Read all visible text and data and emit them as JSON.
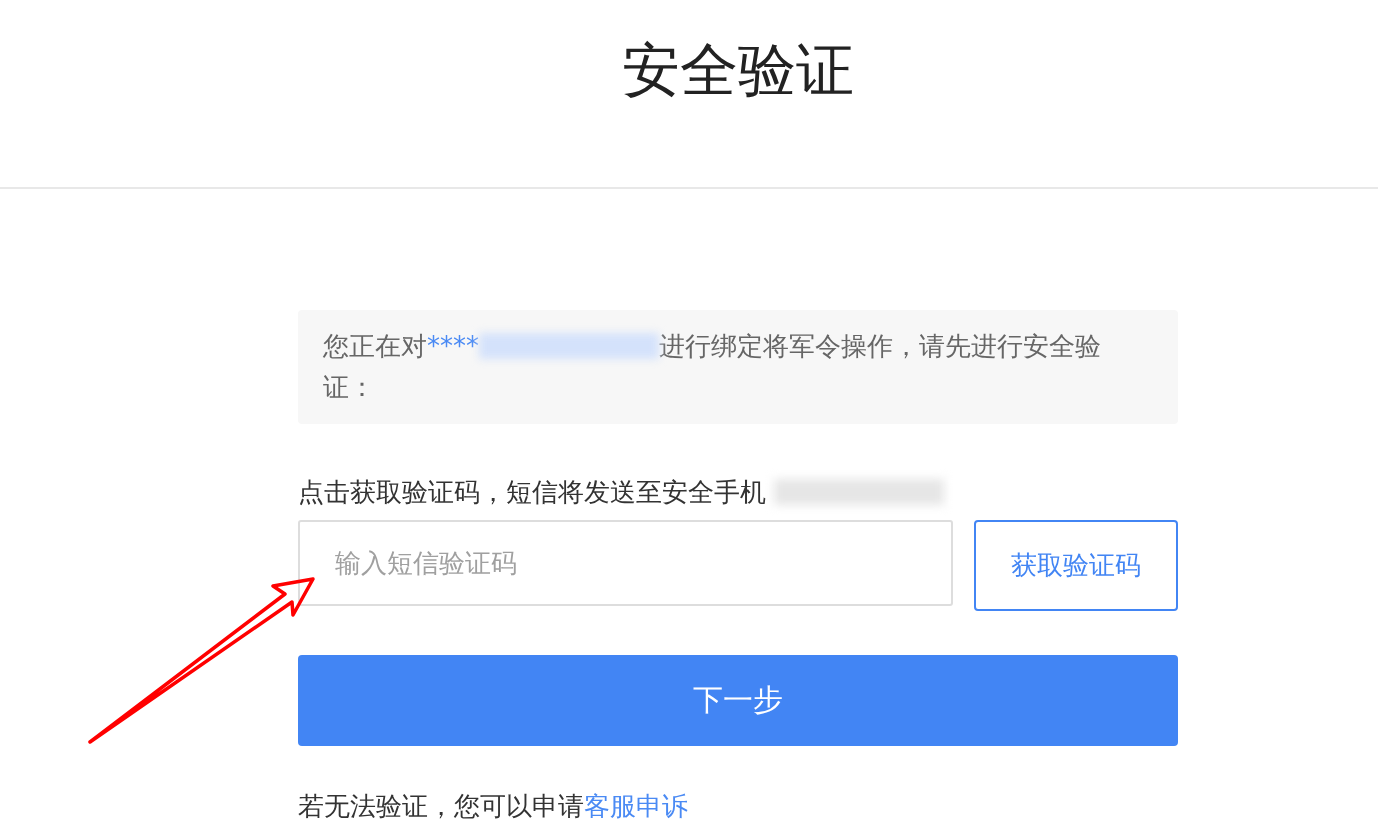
{
  "header": {
    "title": "安全验证"
  },
  "notice": {
    "text_before": "您正在对",
    "account": "****",
    "text_after": "进行绑定将军令操作，请先进行安全验证："
  },
  "sms_hint": {
    "text": "点击获取验证码，短信将发送至安全手机"
  },
  "code_field": {
    "placeholder": "输入短信验证码"
  },
  "get_code_button": {
    "label": "获取验证码"
  },
  "next_button": {
    "label": "下一步"
  },
  "footer": {
    "text": "若无法验证，您可以申请",
    "link": "客服申诉"
  }
}
